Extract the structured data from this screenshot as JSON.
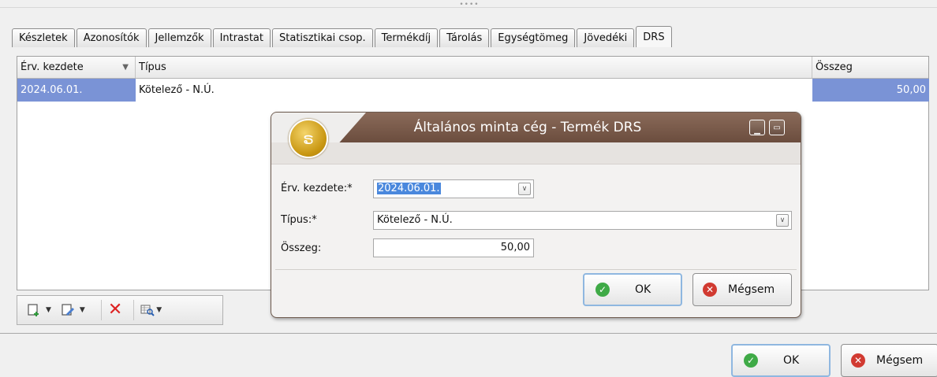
{
  "tabs": [
    "Készletek",
    "Azonosítók",
    "Jellemzők",
    "Intrastat",
    "Statisztikai csop.",
    "Termékdíj",
    "Tárolás",
    "Egységtömeg",
    "Jövedéki",
    "DRS"
  ],
  "grid": {
    "headers": {
      "start": "Érv. kezdete",
      "type": "Típus",
      "amount": "Összeg"
    },
    "rows": [
      {
        "start": "2024.06.01.",
        "type": "Kötelező - N.Ú.",
        "amount": "50,00"
      }
    ]
  },
  "toolbar": {
    "icons": [
      "new-icon",
      "edit-icon",
      "delete-icon",
      "filter-icon"
    ]
  },
  "dialog": {
    "title": "Általános minta cég - Termék DRS",
    "start_label": "Érv. kezdete:*",
    "start_value": "2024.06.01.",
    "type_label": "Típus:*",
    "type_value": "Kötelező - N.Ú.",
    "amount_label": "Összeg:",
    "amount_value": "50,00",
    "ok_label": "OK",
    "cancel_label": "Mégsem"
  },
  "footer": {
    "ok_label": "OK",
    "cancel_label": "Mégsem"
  },
  "colors": {
    "selection": "#7a93d6",
    "title_bar": "#7a5c4c",
    "ok": "#3faa47",
    "cancel": "#d13a31"
  }
}
